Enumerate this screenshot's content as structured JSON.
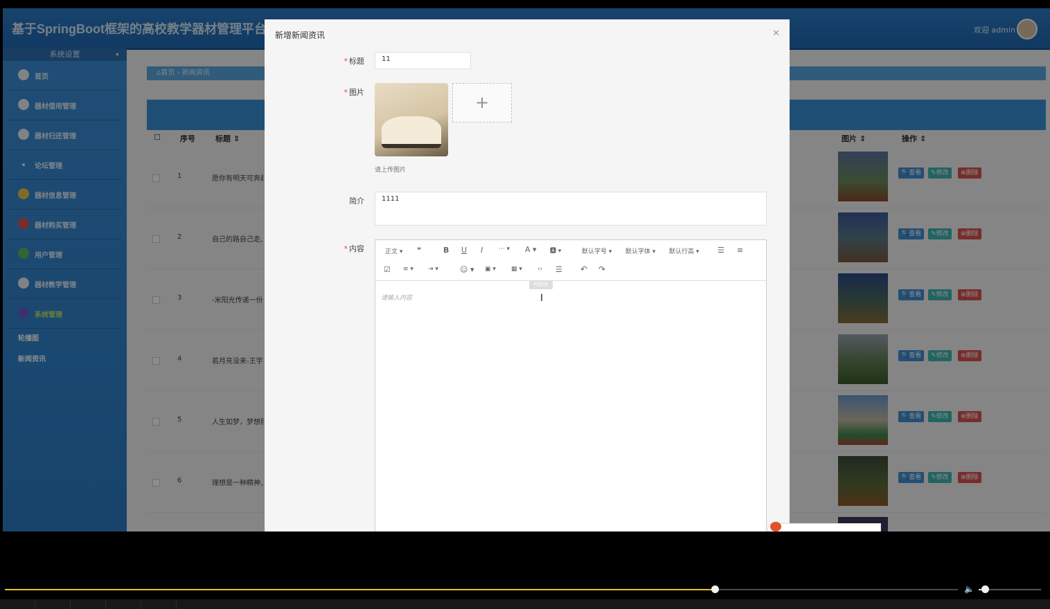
{
  "header": {
    "title": "基于SpringBoot框架的高校教学器材管理平台的",
    "welcome": "欢迎 admin"
  },
  "sidebar": {
    "section": "系统设置",
    "items": [
      {
        "label": "首页",
        "icon": "home-icon"
      },
      {
        "label": "器材借用管理",
        "icon": "borrow-icon"
      },
      {
        "label": "器材归还管理",
        "icon": "return-icon"
      },
      {
        "label": "论坛管理",
        "icon": "forum-icon"
      },
      {
        "label": "器材信息管理",
        "icon": "equipment-info-icon"
      },
      {
        "label": "器材购买管理",
        "icon": "purchase-icon"
      },
      {
        "label": "用户管理",
        "icon": "user-icon"
      },
      {
        "label": "器材教学管理",
        "icon": "teaching-icon"
      },
      {
        "label": "系统管理",
        "icon": "system-icon"
      }
    ],
    "submenu": [
      "轮播图",
      "新闻资讯"
    ]
  },
  "breadcrumb": {
    "home": "首页",
    "current": "新闻资讯"
  },
  "table": {
    "headers": {
      "index": "序号",
      "title": "标题",
      "image": "图片",
      "action": "操作"
    },
    "rows": [
      {
        "index": "1",
        "title": "愿你有明天可奔赴"
      },
      {
        "index": "2",
        "title": "自己的路自己走,"
      },
      {
        "index": "3",
        "title": "-米阳光传递一份"
      },
      {
        "index": "4",
        "title": "若月亮没来-王宇"
      },
      {
        "index": "5",
        "title": "人生如梦，梦想照"
      },
      {
        "index": "6",
        "title": "理想是一种精神上"
      }
    ],
    "actions": {
      "view": "查看",
      "edit": "修改",
      "delete": "删除"
    }
  },
  "modal": {
    "title": "新增新闻资讯",
    "fields": {
      "title_label": "标题",
      "title_value": "11",
      "image_label": "图片",
      "image_hint": "请上传图片",
      "summary_label": "简介",
      "summary_value": "1111",
      "content_label": "内容",
      "content_placeholder": "请输入内容"
    },
    "toolbar": {
      "format": "正文",
      "font_size": "默认字号",
      "font_family": "默认字体",
      "line_height": "默认行高",
      "tooltip": "代码块"
    }
  },
  "player": {
    "progress": 0.745,
    "volume": 0.1
  },
  "colors": {
    "header": "#1f68b3",
    "sidebar": "#2c7cc4",
    "active_menu": "#c4e862",
    "view_btn": "#3f8fd6",
    "edit_btn": "#3db6b0",
    "delete_btn": "#d9534f",
    "progress": "#e6c42a"
  }
}
